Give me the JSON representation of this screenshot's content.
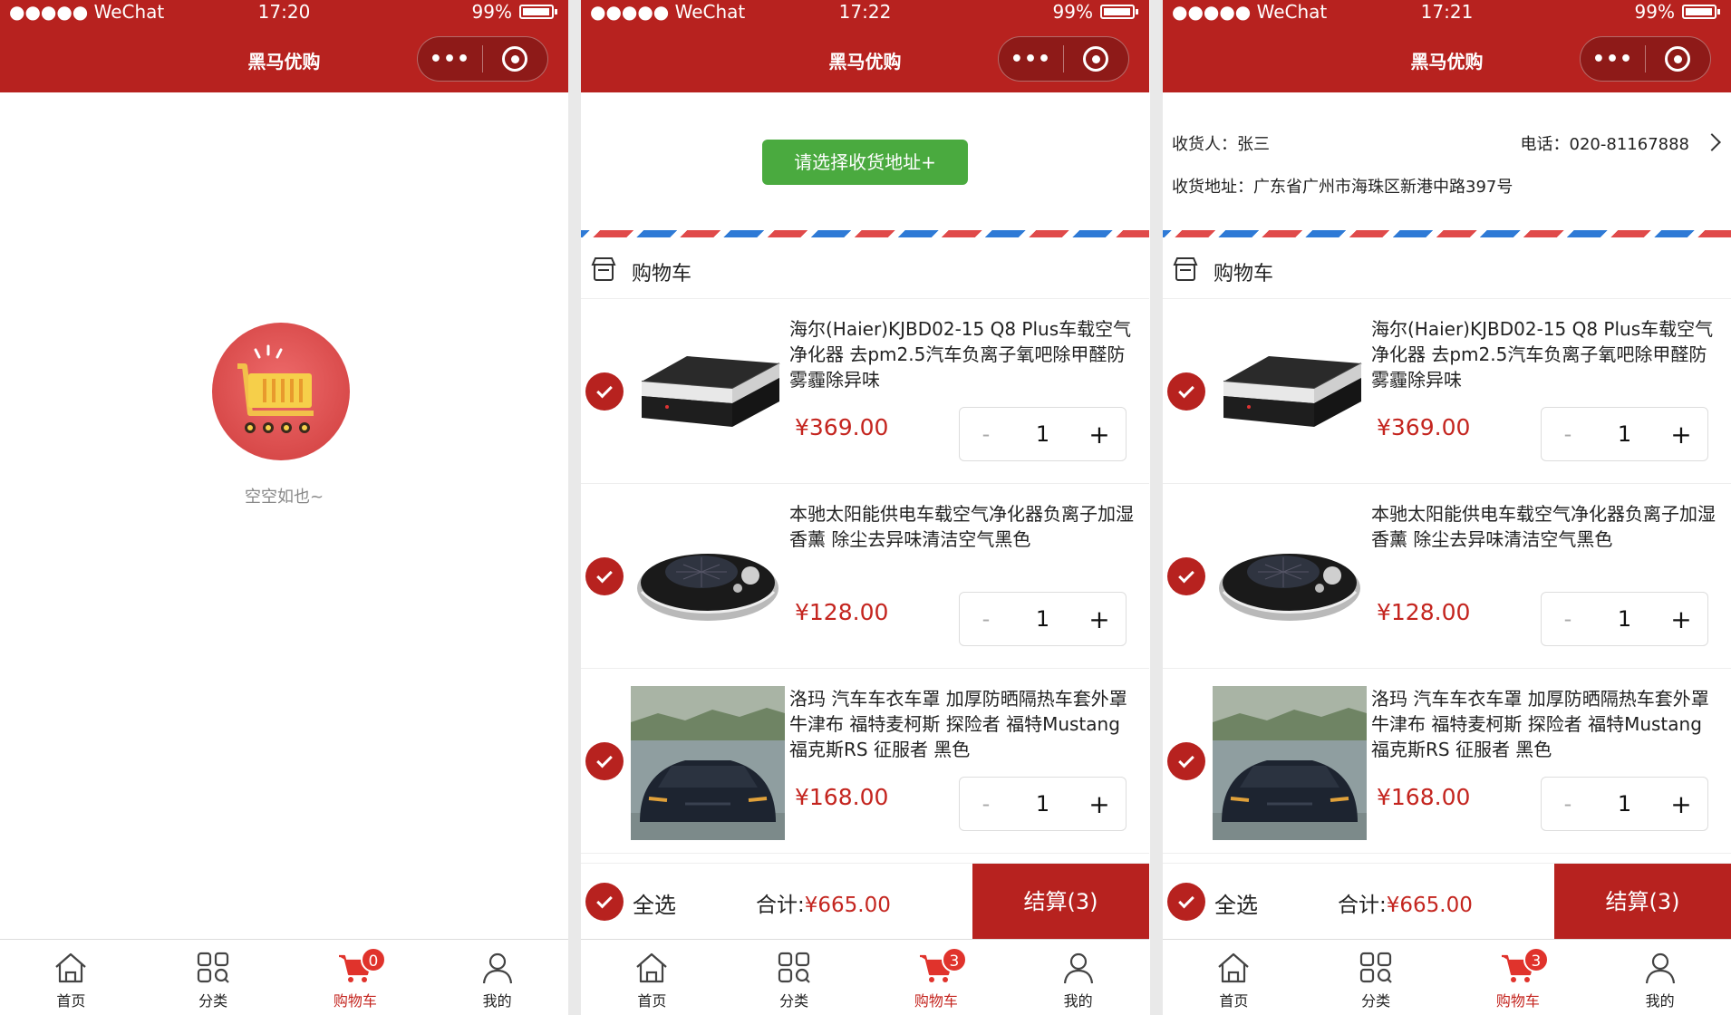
{
  "app": {
    "title": "黑马优购",
    "carrier": "●●●●● WeChat",
    "battery": "99%",
    "capsule_dots": "•••"
  },
  "screens": [
    {
      "time": "17:20",
      "empty_text": "空空如也~",
      "cart_badge": "0"
    },
    {
      "time": "17:22",
      "address_button": "请选择收货地址+",
      "cart_badge": "3"
    },
    {
      "time": "17:21",
      "receiver_label": "收货人：张三",
      "phone_label": "电话：020-81167888",
      "address_label": "收货地址：广东省广州市海珠区新港中路397号",
      "cart_badge": "3"
    }
  ],
  "cart": {
    "title": "购物车",
    "items": [
      {
        "name": "海尔(Haier)KJBD02-15 Q8 Plus车载空气净化器 去pm2.5汽车负离子氧吧除甲醛防雾霾除异味",
        "price": "¥369.00",
        "qty": "1"
      },
      {
        "name": "本驰太阳能供电车载空气净化器负离子加湿香薰 除尘去异味清洁空气黑色",
        "price": "¥128.00",
        "qty": "1"
      },
      {
        "name": "洛玛 汽车车衣车罩 加厚防晒隔热车套外罩牛津布 福特麦柯斯 探险者 福特Mustang 福克斯RS 征服者 黑色",
        "price": "¥168.00",
        "qty": "1"
      }
    ],
    "minus": "-",
    "plus": "+"
  },
  "footer": {
    "select_all": "全选",
    "total_label": "合计:",
    "total_value": "¥665.00",
    "checkout": "结算(3)"
  },
  "tabs": [
    {
      "label": "首页",
      "icon": "home-icon"
    },
    {
      "label": "分类",
      "icon": "category-icon"
    },
    {
      "label": "购物车",
      "icon": "cart-icon"
    },
    {
      "label": "我的",
      "icon": "user-icon"
    }
  ],
  "colors": {
    "brand": "#b7221f",
    "price": "#c4251f",
    "address_button": "#4aaa3f"
  }
}
